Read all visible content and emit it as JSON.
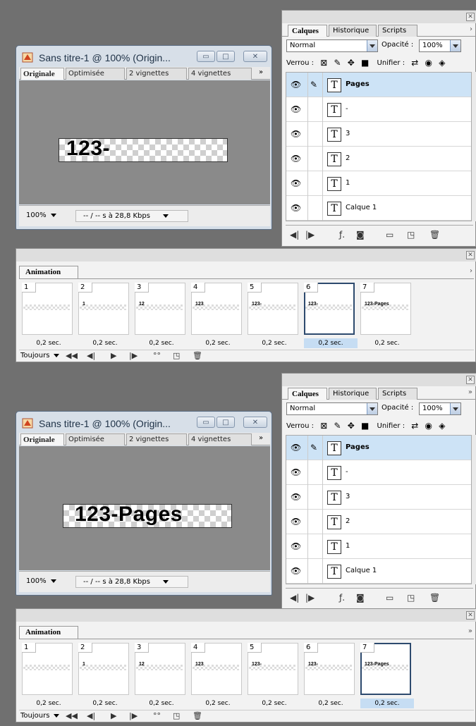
{
  "scenes": [
    {
      "doc": {
        "title": "Sans titre-1 @ 100% (Origin...",
        "tabs": [
          "Originale",
          "Optimisée",
          "2 vignettes",
          "4 vignettes"
        ],
        "tab_more": "»",
        "canvas_text": "123-",
        "zoom": "100%",
        "speed": "-- / -- s à 28,8 Kbps"
      },
      "layers_panel": {
        "tabs": [
          "Calques",
          "Historique",
          "Scripts"
        ],
        "blend": "Normal",
        "opacity_label": "Opacité :",
        "opacity": "100%",
        "lock_label": "Verrou :",
        "unify_label": "Unifier :",
        "layers": [
          "Pages",
          "-",
          "3",
          "2",
          "1",
          "Calque 1"
        ]
      },
      "animation": {
        "title": "Animation",
        "frames": [
          {
            "num": "1",
            "text": "",
            "delay": "0,2 sec."
          },
          {
            "num": "2",
            "text": "1",
            "delay": "0,2 sec."
          },
          {
            "num": "3",
            "text": "12",
            "delay": "0,2 sec."
          },
          {
            "num": "4",
            "text": "123",
            "delay": "0,2 sec."
          },
          {
            "num": "5",
            "text": "123-",
            "delay": "0,2 sec."
          },
          {
            "num": "6",
            "text": "123-",
            "delay": "0,2 sec."
          },
          {
            "num": "7",
            "text": "123-Pages",
            "delay": "0,2 sec."
          }
        ],
        "selected_frame": 6,
        "loop": "Toujours"
      }
    },
    {
      "doc": {
        "title": "Sans titre-1 @ 100% (Origin...",
        "tabs": [
          "Originale",
          "Optimisée",
          "2 vignettes",
          "4 vignettes"
        ],
        "tab_more": "»",
        "canvas_text": "123-Pages",
        "zoom": "100%",
        "speed": "-- / -- s à 28,8 Kbps"
      },
      "layers_panel": {
        "tabs": [
          "Calques",
          "Historique",
          "Scripts"
        ],
        "blend": "Normal",
        "opacity_label": "Opacité :",
        "opacity": "100%",
        "lock_label": "Verrou :",
        "unify_label": "Unifier :",
        "layers": [
          "Pages",
          "-",
          "3",
          "2",
          "1",
          "Calque 1"
        ]
      },
      "animation": {
        "title": "Animation",
        "frames": [
          {
            "num": "1",
            "text": "",
            "delay": "0,2 sec."
          },
          {
            "num": "2",
            "text": "1",
            "delay": "0,2 sec."
          },
          {
            "num": "3",
            "text": "12",
            "delay": "0,2 sec."
          },
          {
            "num": "4",
            "text": "123",
            "delay": "0,2 sec."
          },
          {
            "num": "5",
            "text": "123-",
            "delay": "0,2 sec."
          },
          {
            "num": "6",
            "text": "123-",
            "delay": "0,2 sec."
          },
          {
            "num": "7",
            "text": "123-Pages",
            "delay": "0,2 sec."
          }
        ],
        "selected_frame": 7,
        "loop": "Toujours"
      }
    }
  ]
}
